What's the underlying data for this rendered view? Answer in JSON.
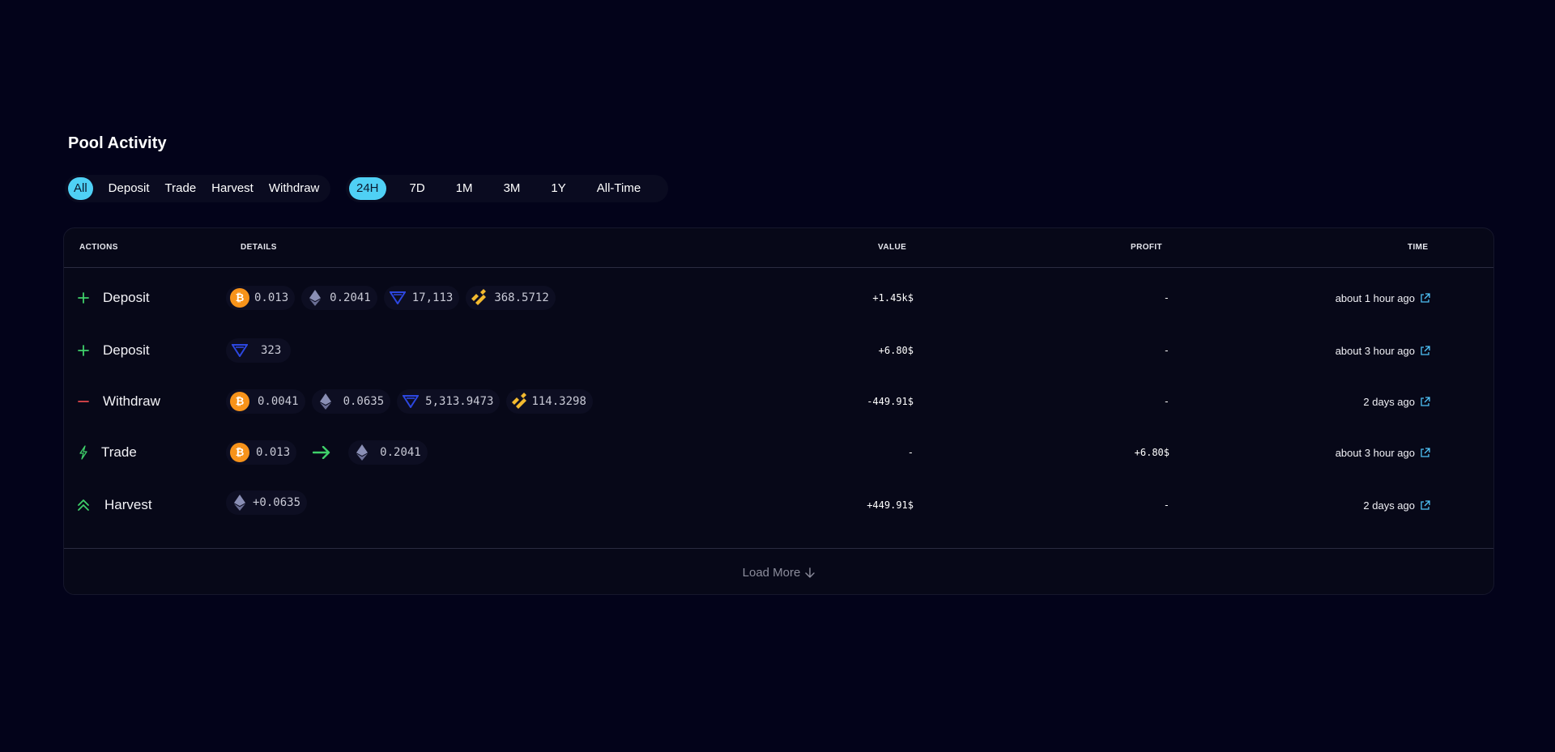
{
  "title": "Pool Activity",
  "action_filters": [
    "All",
    "Deposit",
    "Trade",
    "Harvest",
    "Withdraw"
  ],
  "period_filters": [
    "24H",
    "7D",
    "1M",
    "3M",
    "1Y",
    "All-Time"
  ],
  "active_action_filter": "All",
  "active_period_filter": "24H",
  "table": {
    "headers": {
      "actions": "ACTIONS",
      "details": "DETAILS",
      "value": "VALUE",
      "profit": "PROFIT",
      "time": "TIME"
    },
    "rows": [
      {
        "action": "Deposit",
        "action_icon": "plus-icon",
        "details": [
          {
            "coin": "bitcoin-icon",
            "amount": "0.013"
          },
          {
            "coin": "ethereum-icon",
            "amount": "0.2041"
          },
          {
            "coin": "triangle-token-icon",
            "amount": "17,113"
          },
          {
            "coin": "binance-icon",
            "amount": "368.5712"
          }
        ],
        "value": "+1.45k$",
        "profit": "-",
        "time": "about 1 hour ago"
      },
      {
        "action": "Deposit",
        "action_icon": "plus-icon",
        "details": [
          {
            "coin": "triangle-token-icon",
            "amount": "323"
          }
        ],
        "value": "+6.80$",
        "profit": "-",
        "time": "about 3 hour ago"
      },
      {
        "action": "Withdraw",
        "action_icon": "minus-icon",
        "details": [
          {
            "coin": "bitcoin-icon",
            "amount": "0.0041"
          },
          {
            "coin": "ethereum-icon",
            "amount": "0.0635"
          },
          {
            "coin": "triangle-token-icon",
            "amount": "5,313.9473"
          },
          {
            "coin": "binance-icon",
            "amount": "114.3298"
          }
        ],
        "value": "-449.91$",
        "profit": "-",
        "time": "2 days ago"
      },
      {
        "action": "Trade",
        "action_icon": "lightning-icon",
        "details": [
          {
            "coin": "bitcoin-icon",
            "amount": "0.013"
          },
          {
            "coin": "ethereum-icon",
            "amount": "0.2041"
          }
        ],
        "value": "-",
        "profit": "+6.80$",
        "time": "about 3 hour ago"
      },
      {
        "action": "Harvest",
        "action_icon": "double-chevron-up-icon",
        "details": [
          {
            "coin": "ethereum-icon",
            "amount": "+0.0635"
          }
        ],
        "value": "+449.91$",
        "profit": "-",
        "time": "2 days ago"
      }
    ]
  },
  "load_more": "Load More",
  "colors": {
    "background": "#03031a",
    "accent": "#4fd0f5",
    "positive": "#3fd06a",
    "negative": "#e5484d",
    "bitcoin": "#f7931a",
    "binance": "#f3ba2f",
    "triangle_token": "#2c47e0",
    "link": "#4fc3f7"
  }
}
